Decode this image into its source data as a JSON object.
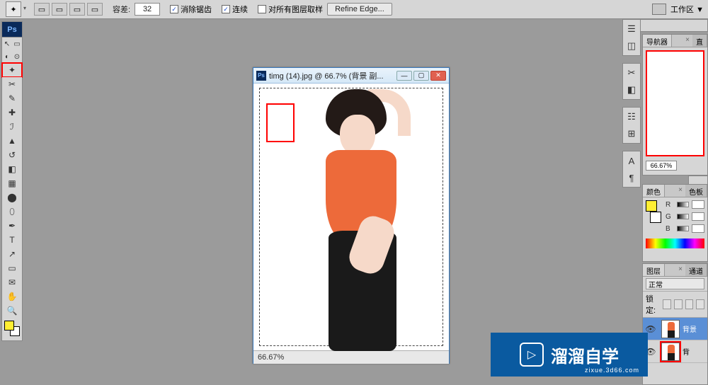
{
  "options": {
    "tolerance_label": "容差:",
    "tolerance_value": "32",
    "antialias_label": "消除锯齿",
    "antialias_checked": "✓",
    "contiguous_label": "连续",
    "contiguous_checked": "✓",
    "all_layers_label": "对所有图层取样",
    "all_layers_checked": "",
    "refine_label": "Refine Edge...",
    "workspace_label": "工作区 ▼"
  },
  "toolbox": {
    "logo": "Ps"
  },
  "document": {
    "title": "timg (14).jpg @ 66.7% (背景 副...",
    "zoom": "66.67%"
  },
  "panels": {
    "navigator": {
      "tab1": "导航器",
      "tab2": "直",
      "zoom": "66.67%"
    },
    "color": {
      "tab1": "颜色",
      "tab2": "色板",
      "r": "R",
      "g": "G",
      "b": "B"
    },
    "layers": {
      "tab1": "图层",
      "tab2": "通道",
      "mode": "正常",
      "lock_label": "锁定:",
      "layer1": "背景",
      "layer2": "背"
    }
  },
  "watermark": {
    "brand": "溜溜自学",
    "url": "zixue.3d66.com",
    "play": "▷"
  }
}
